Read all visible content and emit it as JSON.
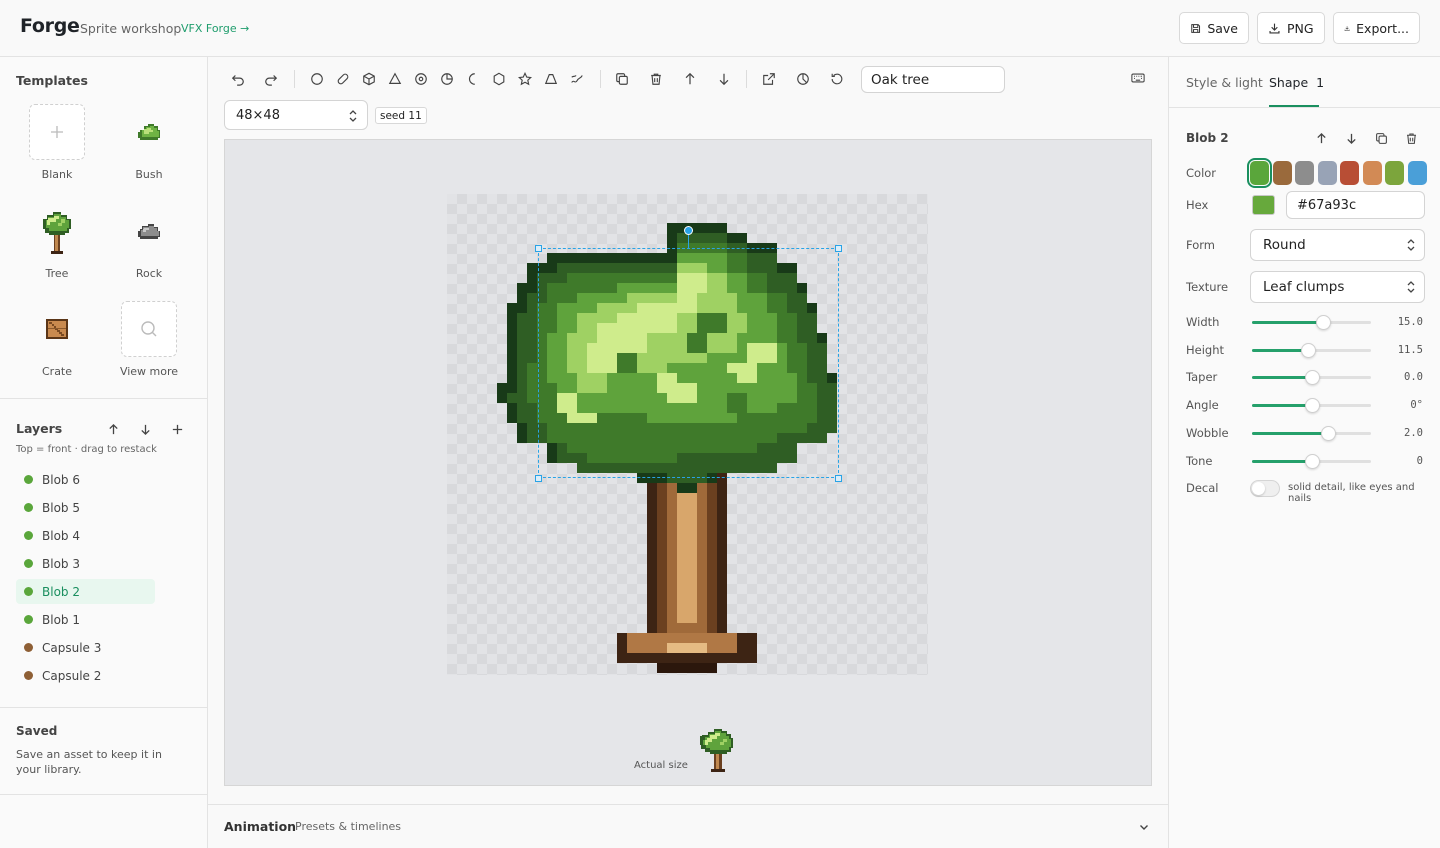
{
  "header": {
    "app_name": "Forge",
    "subtitle": "Sprite workshop",
    "vfx_link": "VFX Forge",
    "buttons": {
      "save": "Save",
      "png": "PNG",
      "export": "Export..."
    }
  },
  "templates": {
    "title": "Templates",
    "items": [
      {
        "label": "Blank"
      },
      {
        "label": "Bush"
      },
      {
        "label": "Tree"
      },
      {
        "label": "Rock"
      },
      {
        "label": "Crate"
      },
      {
        "label": "View more"
      }
    ]
  },
  "layers": {
    "title": "Layers",
    "hint": "Top = front · drag to restack",
    "items": [
      {
        "name": "Blob 6",
        "color": "#5aa63b"
      },
      {
        "name": "Blob 5",
        "color": "#5aa63b"
      },
      {
        "name": "Blob 4",
        "color": "#5aa63b"
      },
      {
        "name": "Blob 3",
        "color": "#5aa63b"
      },
      {
        "name": "Blob 2",
        "color": "#5aa63b",
        "active": true
      },
      {
        "name": "Blob 1",
        "color": "#5aa63b"
      },
      {
        "name": "Capsule 3",
        "color": "#8e5f35"
      },
      {
        "name": "Capsule 2",
        "color": "#8e5f35"
      }
    ]
  },
  "saved": {
    "title": "Saved",
    "text": "Save an asset to keep it in your library."
  },
  "editor": {
    "asset_name": "Oak tree",
    "size": "48×48",
    "seed": "seed 11",
    "actual_size_label": "Actual size"
  },
  "animation": {
    "title": "Animation",
    "subtitle": "Presets & timelines"
  },
  "inspector": {
    "tabs": {
      "style": "Style & light",
      "shape": "Shape",
      "shape_count": "1"
    },
    "selected": "Blob 2",
    "color_label": "Color",
    "swatches": [
      "#5aa63b",
      "#9a6a3c",
      "#8d8d8d",
      "#98a3b6",
      "#b84e35",
      "#d28a55",
      "#7ca53c",
      "#4a9fd8"
    ],
    "hex_label": "Hex",
    "hex_value": "#67a93c",
    "form_label": "Form",
    "form_value": "Round",
    "texture_label": "Texture",
    "texture_value": "Leaf clumps",
    "sliders": [
      {
        "label": "Width",
        "value": "15.0",
        "fraction": 0.6
      },
      {
        "label": "Height",
        "value": "11.5",
        "fraction": 0.47
      },
      {
        "label": "Taper",
        "value": "0.0",
        "fraction": 0.5
      },
      {
        "label": "Angle",
        "value": "0°",
        "fraction": 0.5
      },
      {
        "label": "Wobble",
        "value": "2.0",
        "fraction": 0.64
      },
      {
        "label": "Tone",
        "value": "0",
        "fraction": 0.5
      }
    ],
    "decal_label": "Decal",
    "decal_hint": "solid detail, like eyes and nails",
    "decal_on": false
  },
  "colors": {
    "accent": "#1a8f5f",
    "selection": "#29a3e6"
  }
}
